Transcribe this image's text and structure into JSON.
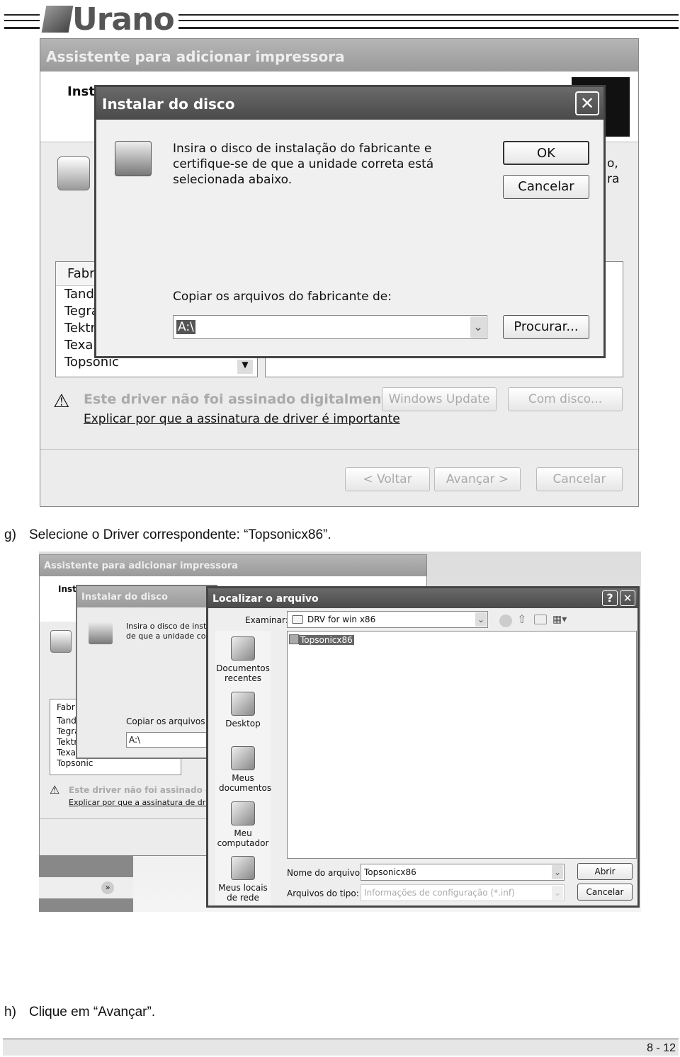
{
  "header": {
    "logo_text": "Urano"
  },
  "screenshot1": {
    "wizard": {
      "title": "Assistente para adicionar impressora",
      "heading_partial": "Inst",
      "side_text_partial": [
        "o,",
        "ra"
      ],
      "list_header_partial": "Fabr",
      "list_items_partial": [
        "Tand",
        "Tegra",
        "Tektr",
        "Texa",
        "Topsonic"
      ],
      "warning_text": "Este driver não foi assinado digitalmente!",
      "warning_link": "Explicar por que a assinatura de driver é importante",
      "windows_update_label": "Windows Update",
      "have_disk_label": "Com disco...",
      "back_label": "< Voltar",
      "next_label": "Avançar >",
      "cancel_label": "Cancelar"
    },
    "install_disk": {
      "title": "Instalar do disco",
      "message": "Insira o disco de instalação do fabricante e certifique-se de que a unidade correta está selecionada abaixo.",
      "ok_label": "OK",
      "cancel_label": "Cancelar",
      "copy_label": "Copiar os arquivos do fabricante de:",
      "copy_value": "A:\\",
      "browse_label": "Procurar..."
    }
  },
  "captions": {
    "g_letter": "g)",
    "g_text": "Selecione o Driver correspondente: “Topsonicx86”.",
    "h_letter": "h)",
    "h_text": "Clique em “Avançar”."
  },
  "screenshot2": {
    "wizard": {
      "title": "Assistente para adicionar impressora",
      "heading_partial": "Inst",
      "list_header_partial": "Fabr",
      "list_items_partial": [
        "Tand",
        "Tegra",
        "Tektr",
        "Texa",
        "Topsonic"
      ],
      "warning_text_partial": "Este driver não foi assinado dig",
      "warning_link_partial": "Explicar por que a assinatura de driver"
    },
    "install_disk": {
      "title": "Instalar do disco",
      "message_partial": [
        "Insira o disco de instal",
        "de que a unidade corr"
      ],
      "copy_label_partial": "Copiar os arquivos do",
      "copy_value": "A:\\"
    },
    "open_dialog": {
      "title": "Localizar o arquivo",
      "help_label": "?",
      "look_in_label": "Examinar:",
      "look_in_value": "DRV for win x86",
      "sidebar": [
        {
          "label": "Documentos recentes",
          "icon": "recent-documents-icon"
        },
        {
          "label": "Desktop",
          "icon": "desktop-icon"
        },
        {
          "label": "Meus documentos",
          "icon": "my-documents-icon"
        },
        {
          "label": "Meu computador",
          "icon": "my-computer-icon"
        },
        {
          "label": "Meus locais de rede",
          "icon": "network-places-icon"
        }
      ],
      "files": [
        {
          "name": "Topsonicx86",
          "selected": true
        }
      ],
      "filename_label": "Nome do arquivo:",
      "filename_value": "Topsonicx86",
      "filetype_label": "Arquivos do tipo:",
      "filetype_value": "Informações de configuração (*.inf)",
      "open_label": "Abrir",
      "cancel_label": "Cancelar"
    }
  },
  "footer": {
    "page_number": "8 - 12"
  }
}
